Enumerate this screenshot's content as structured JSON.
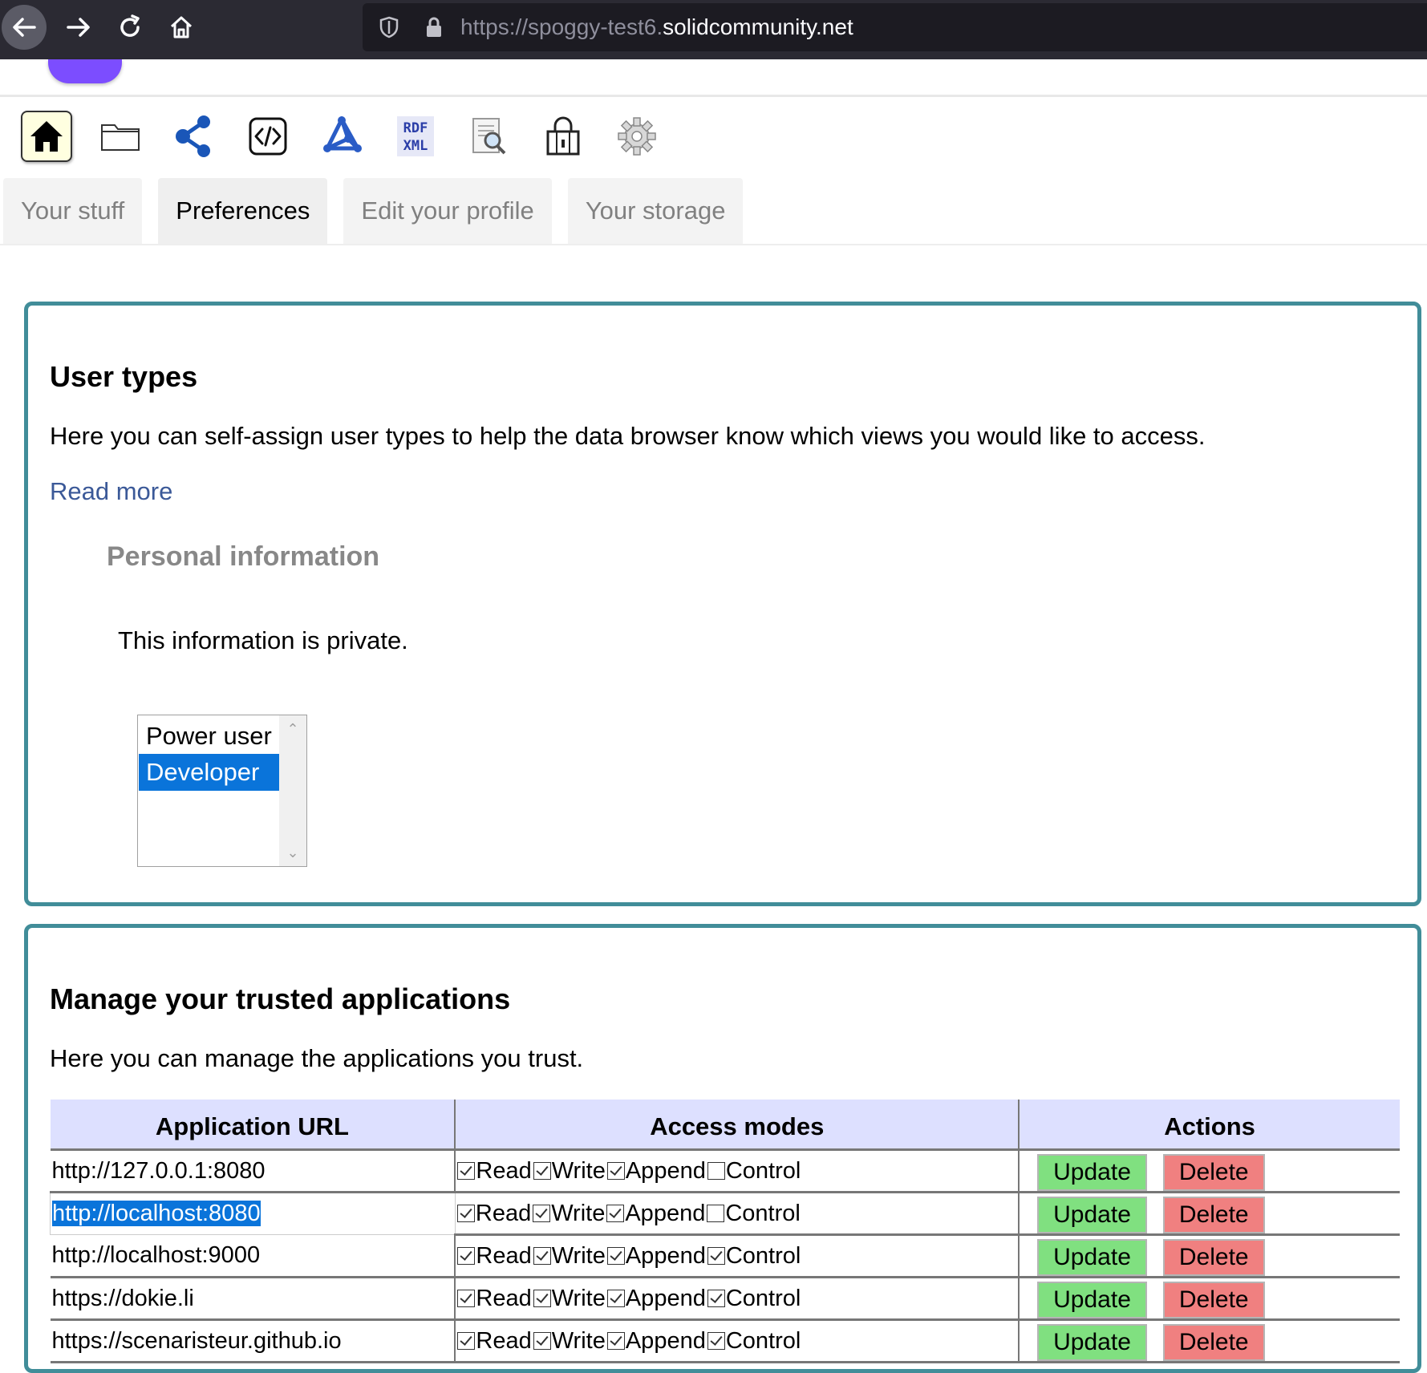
{
  "browser": {
    "url_prefix": "https://spoggy-test6.",
    "url_host": "solidcommunity.net"
  },
  "toolbar": {
    "icons": [
      "home-icon",
      "folder-icon",
      "share-graph-icon",
      "source-code-icon",
      "network-icon",
      "rdf-xml-icon",
      "search-document-icon",
      "lock-icon",
      "gear-icon"
    ],
    "rdf_label_top": "RDF",
    "rdf_label_bottom": "XML"
  },
  "tabs": [
    {
      "label": "Your stuff",
      "selected": false
    },
    {
      "label": "Preferences",
      "selected": true
    },
    {
      "label": "Edit your profile",
      "selected": false
    },
    {
      "label": "Your storage",
      "selected": false
    }
  ],
  "user_types": {
    "title": "User types",
    "description": "Here you can self-assign user types to help the data browser know which views you would like to access.",
    "read_more": "Read more",
    "personal_info_heading": "Personal information",
    "private_note": "This information is private.",
    "options": [
      {
        "label": "Power user",
        "selected": false
      },
      {
        "label": "Developer",
        "selected": true
      }
    ]
  },
  "trusted_apps": {
    "title": "Manage your trusted applications",
    "description": "Here you can manage the applications you trust.",
    "columns": [
      "Application URL",
      "Access modes",
      "Actions"
    ],
    "mode_labels": [
      "Read",
      "Write",
      "Append",
      "Control"
    ],
    "update_label": "Update",
    "delete_label": "Delete",
    "rows": [
      {
        "url": "http://127.0.0.1:8080",
        "modes": [
          true,
          true,
          true,
          false
        ],
        "editing": false
      },
      {
        "url": "http://localhost:8080",
        "modes": [
          true,
          true,
          true,
          false
        ],
        "editing": true
      },
      {
        "url": "http://localhost:9000",
        "modes": [
          true,
          true,
          true,
          true
        ],
        "editing": false
      },
      {
        "url": "https://dokie.li",
        "modes": [
          true,
          true,
          true,
          true
        ],
        "editing": false
      },
      {
        "url": "https://scenaristeur.github.io",
        "modes": [
          true,
          true,
          true,
          true
        ],
        "editing": false
      }
    ]
  }
}
